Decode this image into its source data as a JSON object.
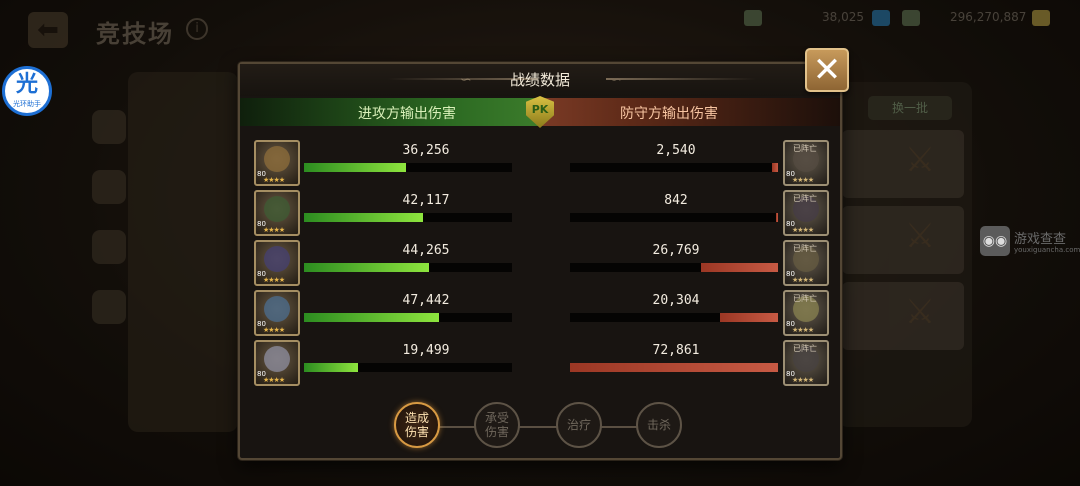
{
  "background": {
    "arena_title": "竞技场",
    "info_glyph": "i",
    "gems_value": "38,025",
    "gold_value": "296,270,887",
    "right_button": "换一批",
    "watermark_text": "游戏查查",
    "watermark_url": "youxiguancha.com",
    "logo_glyph": "光",
    "logo_text": "光环助手"
  },
  "dialog": {
    "title": "战绩数据",
    "close_glyph": "✕",
    "attacker_label": "进攻方输出伤害",
    "defender_label": "防守方输出伤害",
    "pk_label": "PK",
    "colors": {
      "attack": "#8ee53e",
      "defend": "#c75a44",
      "accent": "#d89a43"
    }
  },
  "rows": [
    {
      "att_damage": "36,256",
      "att_fraction": 0.49,
      "def_damage": "2,540",
      "def_fraction": 0.03,
      "att_level": "80",
      "def_level": "80",
      "stars": "★★★★",
      "def_status": "已阵亡"
    },
    {
      "att_damage": "42,117",
      "att_fraction": 0.57,
      "def_damage": "842",
      "def_fraction": 0.01,
      "att_level": "80",
      "def_level": "80",
      "stars": "★★★★",
      "def_status": "已阵亡"
    },
    {
      "att_damage": "44,265",
      "att_fraction": 0.6,
      "def_damage": "26,769",
      "def_fraction": 0.37,
      "att_level": "80",
      "def_level": "80",
      "stars": "★★★★",
      "def_status": "已阵亡"
    },
    {
      "att_damage": "47,442",
      "att_fraction": 0.65,
      "def_damage": "20,304",
      "def_fraction": 0.28,
      "att_level": "80",
      "def_level": "80",
      "stars": "★★★★",
      "def_status": "已阵亡"
    },
    {
      "att_damage": "19,499",
      "att_fraction": 0.26,
      "def_damage": "72,861",
      "def_fraction": 1.0,
      "att_level": "80",
      "def_level": "80",
      "stars": "★★★★",
      "def_status": "已阵亡"
    }
  ],
  "tabs": [
    {
      "label": "造成伤害",
      "active": true
    },
    {
      "label": "承受伤害",
      "active": false
    },
    {
      "label": "治疗",
      "active": false
    },
    {
      "label": "击杀",
      "active": false
    }
  ]
}
